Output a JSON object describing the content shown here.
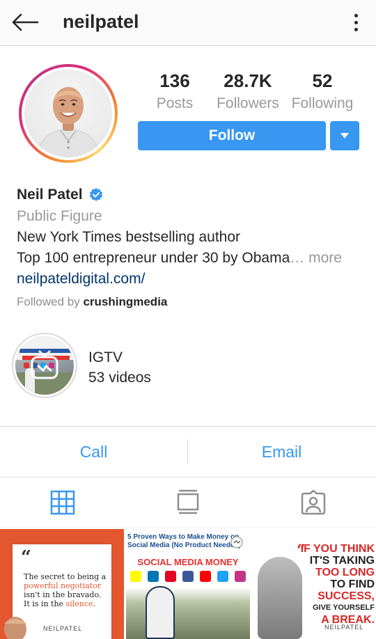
{
  "header": {
    "username": "neilpatel"
  },
  "profile": {
    "stats": [
      {
        "value": "136",
        "label": "Posts"
      },
      {
        "value": "28.7K",
        "label": "Followers"
      },
      {
        "value": "52",
        "label": "Following"
      }
    ],
    "follow_label": "Follow",
    "name": "Neil Patel",
    "verified": true,
    "category": "Public Figure",
    "bio_line1": "New York Times bestselling author",
    "bio_line2": "Top 100 entrepreneur under 30 by Obama",
    "bio_more": "… more",
    "link": "neilpateldigital.com/",
    "followed_by_prefix": "Followed by",
    "followed_by_user": "crushingmedia"
  },
  "igtv": {
    "title": "IGTV",
    "count": "53 videos"
  },
  "contact": {
    "call_label": "Call",
    "email_label": "Email"
  },
  "tabs": [
    {
      "icon": "grid-icon",
      "active": true
    },
    {
      "icon": "feed-icon",
      "active": false
    },
    {
      "icon": "tagged-icon",
      "active": false
    }
  ],
  "posts": [
    {
      "quote_mark": "“",
      "text_before": "The secret to being a ",
      "highlight1": "powerful negotiator",
      "text_middle": " isn't in the bravado. It is in the ",
      "highlight2": "silence",
      "text_end": ".",
      "signature": "NEILPATEL"
    },
    {
      "title": "5 Proven Ways to Make Money on Social Media (No Product Needed)",
      "banner": "SOCIAL MEDIA MONEY"
    },
    {
      "quote_mark": "“",
      "line1": "IF YOU THINK",
      "line2": "IT'S TAKING",
      "line3": "TOO LONG",
      "line4": "TO FIND",
      "line5": "SUCCESS,",
      "line6": "GIVE YOURSELF",
      "line7": "A BREAK.",
      "signature": "NEILPATEL"
    }
  ],
  "colors": {
    "accent": "#3897f0",
    "link": "#003569",
    "muted": "#999999",
    "verified": "#3897f0"
  }
}
